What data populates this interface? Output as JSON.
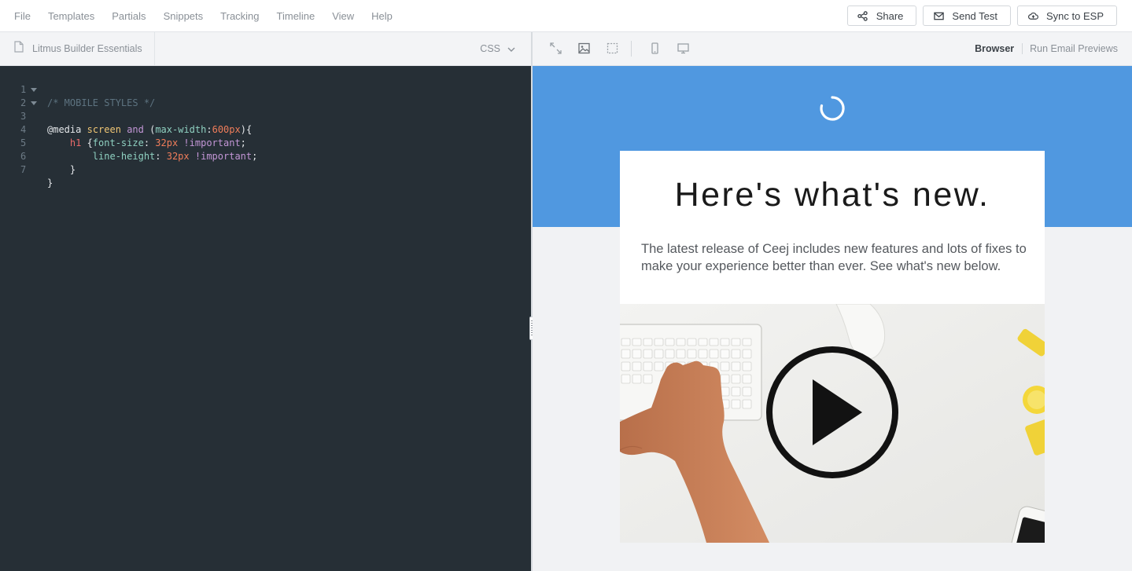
{
  "menu": {
    "items": [
      "File",
      "Templates",
      "Partials",
      "Snippets",
      "Tracking",
      "Timeline",
      "View",
      "Help"
    ]
  },
  "actions": {
    "share": "Share",
    "send_test": "Send Test",
    "sync": "Sync to ESP"
  },
  "editor": {
    "file_name": "Litmus Builder Essentials",
    "language": "CSS",
    "line_numbers": [
      "1",
      "2",
      "3",
      "4",
      "5",
      "6",
      "7"
    ],
    "lines": [
      "/* MOBILE STYLES */",
      "@media screen and (max-width:600px){",
      "    h1 {",
      "        font-size: 32px !important;",
      "        line-height: 32px !important;",
      "    }",
      "}"
    ]
  },
  "preview": {
    "browser_link": "Browser",
    "run_link": "Run Email Previews",
    "tools": [
      "expand-icon",
      "image-icon",
      "selection-icon",
      "mobile-icon",
      "desktop-icon"
    ],
    "email": {
      "heading": "Here's what's new.",
      "body": "The latest release of Ceej includes new features and lots of fixes to make your experience better than ever. See what's new below."
    },
    "colors": {
      "hero": "#5098e0",
      "editor_bg": "#262f36"
    }
  }
}
